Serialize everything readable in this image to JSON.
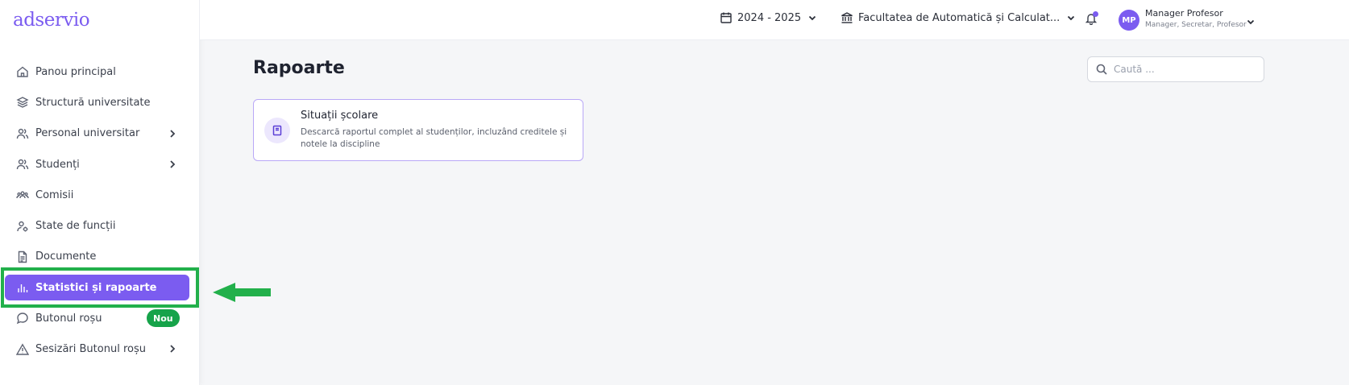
{
  "app": {
    "logo": "adservio"
  },
  "sidebar": {
    "items": [
      {
        "label": "Panou principal",
        "icon": "home-icon"
      },
      {
        "label": "Structură universitate",
        "icon": "layers-icon"
      },
      {
        "label": "Personal universitar",
        "icon": "users-icon",
        "has_submenu": true
      },
      {
        "label": "Studenți",
        "icon": "users-icon",
        "has_submenu": true
      },
      {
        "label": "Comisii",
        "icon": "group-icon"
      },
      {
        "label": "State de funcții",
        "icon": "user-settings-icon"
      },
      {
        "label": "Documente",
        "icon": "document-icon"
      },
      {
        "label": "Statistici și rapoarte",
        "icon": "bar-chart-icon",
        "active": true
      },
      {
        "label": "Butonul roșu",
        "icon": "chat-bubble-icon",
        "badge": "Nou"
      },
      {
        "label": "Sesizări Butonul roșu",
        "icon": "warning-icon",
        "has_submenu": true
      }
    ]
  },
  "topbar": {
    "year": "2024 - 2025",
    "faculty": "Facultatea de Automatică și Calculat...",
    "user": {
      "initials": "MP",
      "name": "Manager Profesor",
      "roles": "Manager, Secretar, Profesor"
    }
  },
  "main": {
    "title": "Rapoarte",
    "search": {
      "placeholder": "Caută ...",
      "value": ""
    },
    "cards": [
      {
        "title": "Situații școlare",
        "description": "Descarcă raportul complet al studenților, incluzând creditele și notele la discipline"
      }
    ]
  },
  "colors": {
    "accent": "#7b5cf0",
    "badge": "#16a34a",
    "annotation": "#22b04b"
  }
}
